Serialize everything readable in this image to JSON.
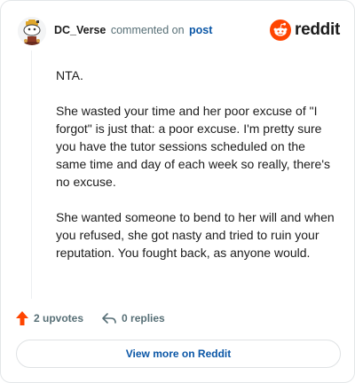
{
  "comment": {
    "username": "DC_Verse",
    "action_text": "commented on",
    "target_text": "post",
    "paragraphs": [
      "NTA.",
      "She wasted your time and her poor excuse of \"I forgot\" is just that: a poor excuse. I'm pretty sure you have the tutor sessions scheduled on the same time and day of each week so really, there's no excuse.",
      "She wanted someone to bend to her will and when you refused, she got nasty and tried to ruin your reputation. You fought back, as anyone would."
    ]
  },
  "brand": {
    "wordmark": "reddit",
    "accent_color": "#ff4500",
    "icon": "reddit-snoo-icon"
  },
  "actions": {
    "upvotes_label": "2 upvotes",
    "replies_label": "0 replies",
    "upvote_icon": "upvote-arrow-icon",
    "reply_icon": "reply-arrow-icon"
  },
  "footer": {
    "button_label": "View more on Reddit",
    "link_color": "#0a56a6"
  }
}
